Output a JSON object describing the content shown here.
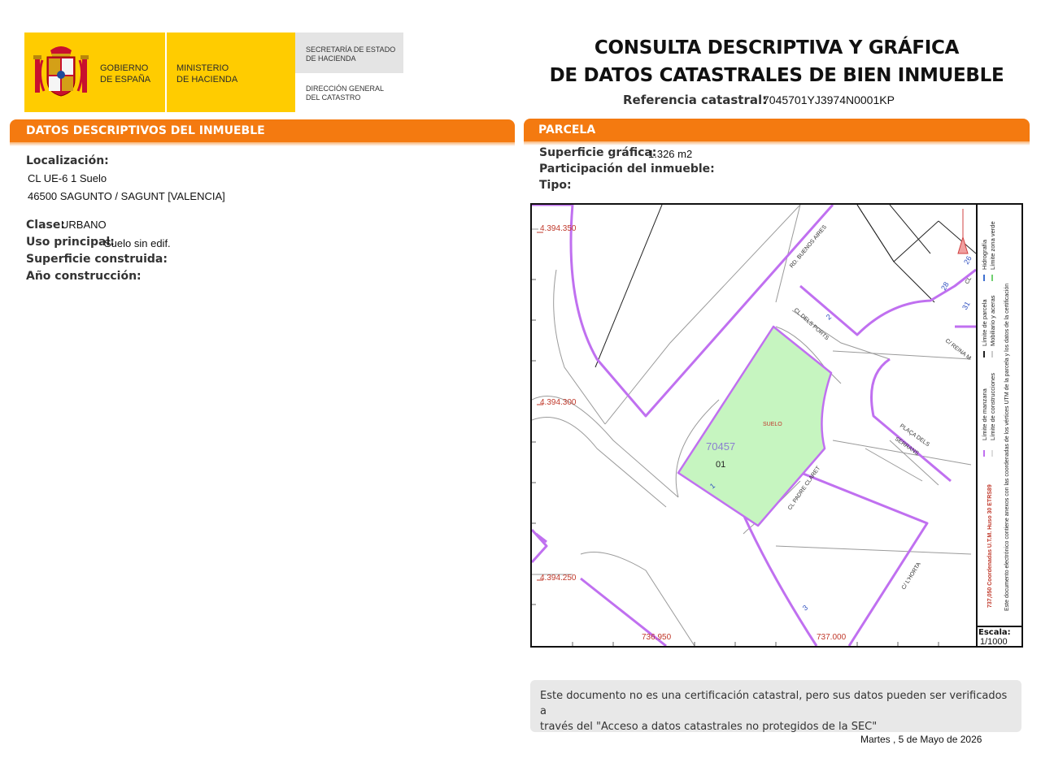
{
  "header": {
    "gobierno_line1": "GOBIERNO",
    "gobierno_line2": "DE ESPAÑA",
    "ministerio_line1": "MINISTERIO",
    "ministerio_line2": "DE HACIENDA",
    "secretaria_line1": "SECRETARÍA DE ESTADO",
    "secretaria_line2": "DE HACIENDA",
    "direccion_line1": "DIRECCIÓN GENERAL",
    "direccion_line2": "DEL CATASTRO",
    "title_line1": "CONSULTA DESCRIPTIVA Y GRÁFICA",
    "title_line2": "DE DATOS CATASTRALES DE BIEN INMUEBLE",
    "refcat_label": "Referencia catastral:",
    "refcat_value": "7045701YJ3974N0001KP"
  },
  "datos": {
    "section_title": "DATOS DESCRIPTIVOS DEL INMUEBLE",
    "localizacion_label": "Localización:",
    "localizacion_line1": "CL UE-6 1 Suelo",
    "localizacion_line2": "46500 SAGUNTO / SAGUNT [VALENCIA]",
    "clase_label": "Clase:",
    "clase_value": "URBANO",
    "uso_label": "Uso principal:",
    "uso_value": "Suelo sin edif.",
    "superficie_label": "Superficie construida:",
    "anio_label": "Año construcción:"
  },
  "parcela": {
    "section_title": "PARCELA",
    "superficie_label": "Superficie gráfica:",
    "superficie_value": "1.326 m2",
    "participacion_label": "Participación del inmueble:",
    "tipo_label": "Tipo:"
  },
  "map": {
    "y_labels": [
      "4.394.350",
      "4.394.300",
      "4.394.250"
    ],
    "x_labels": [
      "736.950",
      "737.000"
    ],
    "parcel_number": "70457",
    "parcel_sub": "01",
    "suelo_label": "SUELO",
    "streets": [
      "RD. BUENOS AIRES",
      "CL DELS PORTS",
      "C/ REINA M",
      "PLAÇA DELS",
      "SERRANS",
      "CL PADRE CLARET",
      "C/ L'HORTA",
      "CL"
    ],
    "numbers": [
      "2",
      "1",
      "3",
      "28",
      "26",
      "31"
    ],
    "parcel_fill": "#c6f5c0",
    "boundary_color": "#c070f0",
    "label_red": "#c0392b"
  },
  "legend": {
    "limite_manzana": "Límite de manzana",
    "limite_construcciones": "Límite de construcciones",
    "limite_parcela": "Límite de parcela",
    "mobiliario": "Mobiliario y aceras",
    "hidrografia": "Hidrografía",
    "zona_verde": "Límite zona verde",
    "coords": "737,050 Coordenadas U.T.M. Huso 30 ETRS89",
    "electronic": "Este documento electrónico contiene anexos con las coordenadas de los vértices UTM de la parcela y los datos de la certificación",
    "escala_label": "Escala:",
    "escala_value": "1/1000"
  },
  "footer": {
    "note_line1": "Este documento no es una certificación catastral, pero sus datos pueden ser verificados a",
    "note_line2": "través del \"Acceso a datos catastrales no protegidos de la SEC\"",
    "date": "Martes , 5 de Mayo de 2026"
  }
}
